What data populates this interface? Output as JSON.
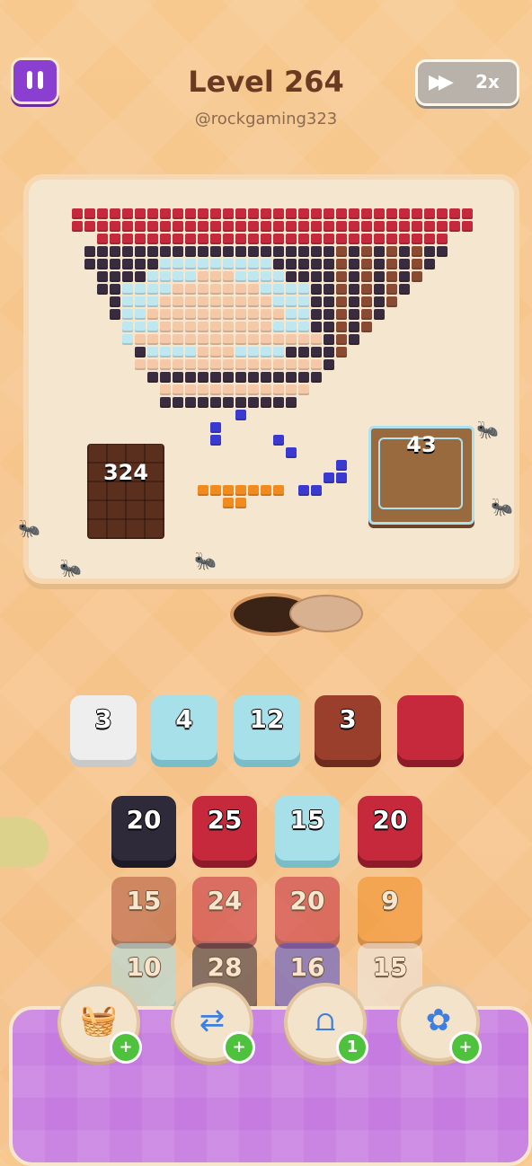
{
  "header": {
    "title": "Level 264",
    "handle": "@rockgaming323",
    "speed_label": "2x"
  },
  "board": {
    "chocolate_count": "324",
    "crate_count": "43"
  },
  "slots": [
    {
      "value": "3",
      "color": "#eeeeee"
    },
    {
      "value": "4",
      "color": "#a8e0ea"
    },
    {
      "value": "12",
      "color": "#a8e0ea"
    },
    {
      "value": "3",
      "color": "#9a3f2b"
    },
    {
      "value": "",
      "color": "#c6283c"
    }
  ],
  "tiles": [
    {
      "value": "20",
      "color": "#2e2a3a"
    },
    {
      "value": "25",
      "color": "#c6283c"
    },
    {
      "value": "15",
      "color": "#a8e0ea"
    },
    {
      "value": "20",
      "color": "#c6283c"
    },
    {
      "value": "15",
      "color": "#b0543a"
    },
    {
      "value": "24",
      "color": "#c6283c"
    },
    {
      "value": "20",
      "color": "#c6283c"
    },
    {
      "value": "9",
      "color": "#f28b1e"
    },
    {
      "value": "10",
      "color": "#a8e0ea"
    },
    {
      "value": "28",
      "color": "#2e2a3a"
    },
    {
      "value": "16",
      "color": "#4a4ad0"
    },
    {
      "value": "15",
      "color": "#eeeeee"
    }
  ],
  "boosters": [
    {
      "icon": "add-box-icon",
      "badge": "+"
    },
    {
      "icon": "shuffle-arrows-icon",
      "badge": "+"
    },
    {
      "icon": "magnet-claw-icon",
      "badge": "1"
    },
    {
      "icon": "flower-bomb-icon",
      "badge": "+"
    }
  ]
}
